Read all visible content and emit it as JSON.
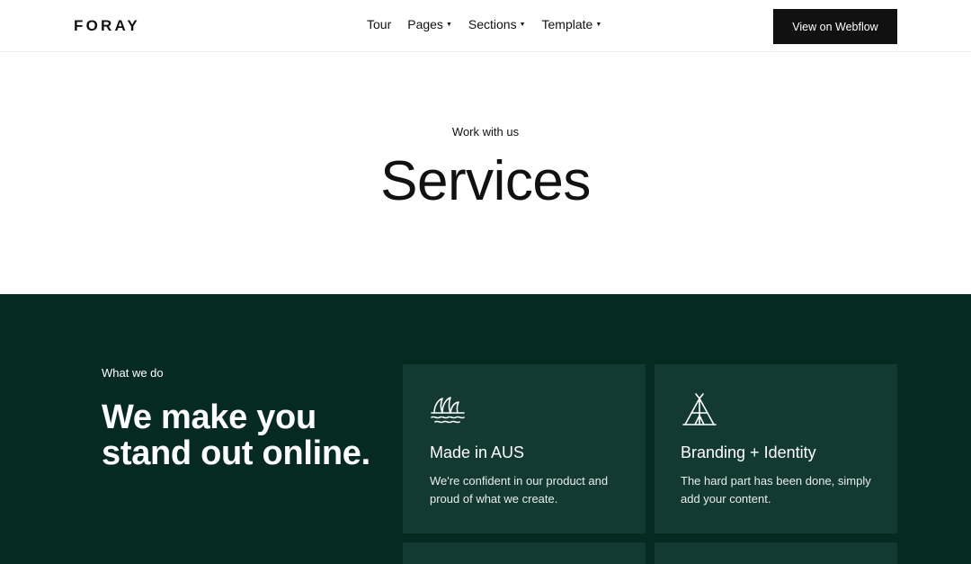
{
  "nav": {
    "logo": "FORAY",
    "links": [
      {
        "label": "Tour",
        "dropdown": false
      },
      {
        "label": "Pages",
        "dropdown": true
      },
      {
        "label": "Sections",
        "dropdown": true
      },
      {
        "label": "Template",
        "dropdown": true
      }
    ],
    "cta_label": "View on Webflow"
  },
  "hero": {
    "eyebrow": "Work with us",
    "title": "Services"
  },
  "services": {
    "eyebrow": "What we do",
    "title": "We make you stand out online.",
    "cards": [
      {
        "icon": "opera-house-icon",
        "title": "Made in AUS",
        "text": "We're confident in our product and proud of what we create."
      },
      {
        "icon": "teepee-icon",
        "title": "Branding + Identity",
        "text": "The hard part has been done, simply add your content."
      }
    ]
  },
  "colors": {
    "dark_bg": "#052a22",
    "card_bg": "#133a32",
    "button_bg": "#111111"
  }
}
